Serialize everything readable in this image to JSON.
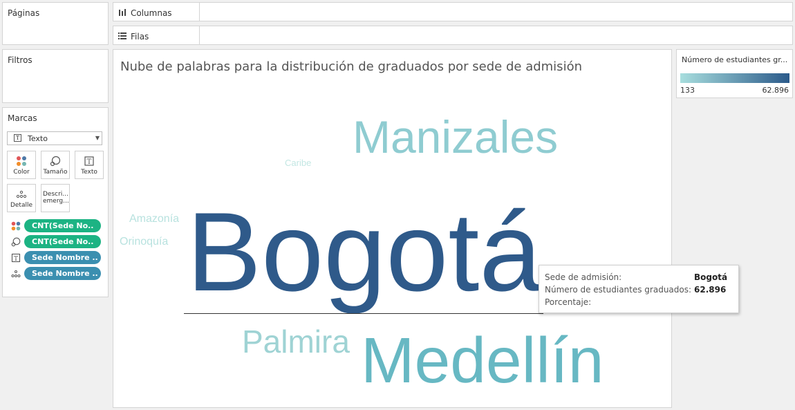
{
  "pages_panel": {
    "title": "Páginas"
  },
  "filters_panel": {
    "title": "Filtros"
  },
  "marks_panel": {
    "title": "Marcas",
    "mark_type": "Texto",
    "buttons": [
      {
        "label": "Color",
        "icon": "color-icon"
      },
      {
        "label": "Tamaño",
        "icon": "size-icon"
      },
      {
        "label": "Texto",
        "icon": "text-icon"
      },
      {
        "label": "Detalle",
        "icon": "detail-icon"
      },
      {
        "label": "Descri... emerg...",
        "icon": "tooltip-icon"
      }
    ],
    "pills": [
      {
        "label": "CNT(Sede No..",
        "icon": "color-icon",
        "color": "#1cb383"
      },
      {
        "label": "CNT(Sede No..",
        "icon": "size-icon",
        "color": "#1cb383"
      },
      {
        "label": "Sede Nombre ..",
        "icon": "text-icon",
        "color": "#3b8fb0"
      },
      {
        "label": "Sede Nombre ..",
        "icon": "detail-icon",
        "color": "#3b8fb0"
      }
    ]
  },
  "shelves": {
    "columns": {
      "label": "Columnas",
      "icon": "columns-icon"
    },
    "rows": {
      "label": "Filas",
      "icon": "rows-icon"
    }
  },
  "viz": {
    "title": "Nube de palabras para la distribución de graduados por sede de admisión"
  },
  "chart_data": {
    "type": "word-cloud",
    "title": "Nube de palabras para la distribución de graduados por sede de admisión",
    "color_measure": "Número de estudiantes gr...",
    "color_range": {
      "min": 133,
      "max": 62896,
      "min_label": "133",
      "max_label": "62.896",
      "min_color": "#a8dede",
      "max_color": "#2b5a8a"
    },
    "words": [
      {
        "text": "Bogotá",
        "value": 62896,
        "color": "#2f5a8a"
      },
      {
        "text": "Medellín",
        "color": "#67b8c3"
      },
      {
        "text": "Manizales",
        "color": "#8fccd1"
      },
      {
        "text": "Palmira",
        "color": "#9fd3d4"
      },
      {
        "text": "Amazonía",
        "color": "#b8e2df"
      },
      {
        "text": "Orinoquía",
        "color": "#b8e2df"
      },
      {
        "text": "Caribe",
        "color": "#c3e7e3"
      }
    ]
  },
  "legend": {
    "title": "Número de estudiantes gr...",
    "min_label": "133",
    "max_label": "62.896"
  },
  "tooltip": {
    "rows": [
      {
        "label": "Sede de admisión:",
        "value": "Bogotá"
      },
      {
        "label": "Número de estudiantes graduados:",
        "value": "62.896"
      },
      {
        "label": "Porcentaje:",
        "value": ""
      }
    ]
  }
}
